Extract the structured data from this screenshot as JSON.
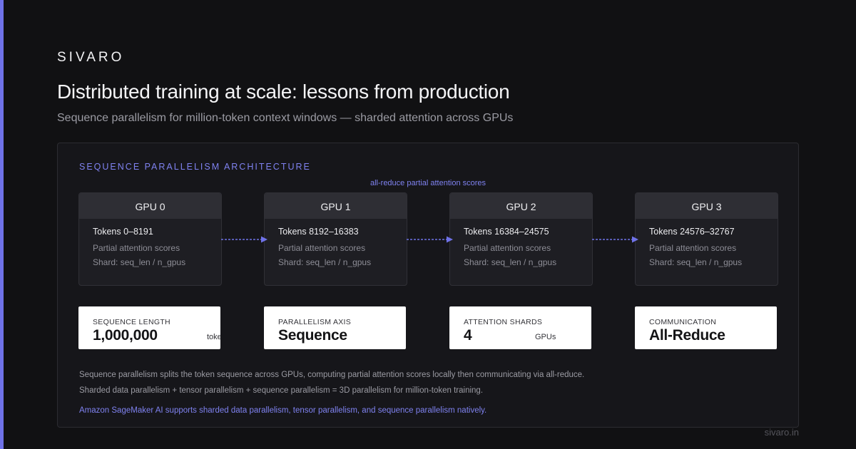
{
  "brand": "SIVARO",
  "title": "Distributed training at scale: lessons from production",
  "subtitle": "Sequence parallelism for million-token context windows — sharded attention across GPUs",
  "diagram": {
    "section_label": "SEQUENCE PARALLELISM ARCHITECTURE",
    "allreduce_label": "all-reduce partial attention scores",
    "gpus": [
      {
        "name": "GPU 0",
        "tokens": "Tokens 0–8191",
        "line1": "Partial attention scores",
        "line2": "Shard: seq_len / n_gpus"
      },
      {
        "name": "GPU 1",
        "tokens": "Tokens 8192–16383",
        "line1": "Partial attention scores",
        "line2": "Shard: seq_len / n_gpus"
      },
      {
        "name": "GPU 2",
        "tokens": "Tokens 16384–24575",
        "line1": "Partial attention scores",
        "line2": "Shard: seq_len / n_gpus"
      },
      {
        "name": "GPU 3",
        "tokens": "Tokens 24576–32767",
        "line1": "Partial attention scores",
        "line2": "Shard: seq_len / n_gpus"
      }
    ],
    "stats": [
      {
        "label": "SEQUENCE LENGTH",
        "value": "1,000,000",
        "unit": "tokens"
      },
      {
        "label": "PARALLELISM AXIS",
        "value": "Sequence",
        "unit": ""
      },
      {
        "label": "ATTENTION SHARDS",
        "value": "4",
        "unit": "GPUs"
      },
      {
        "label": "COMMUNICATION",
        "value": "All-Reduce",
        "unit": ""
      }
    ],
    "notes": [
      "Sequence parallelism splits the token sequence across GPUs, computing partial attention scores locally then communicating via all-reduce.",
      "Sharded data parallelism + tensor parallelism + sequence parallelism = 3D parallelism for million-token training."
    ],
    "accent_note": "Amazon SageMaker AI supports sharded data parallelism, tensor parallelism, and sequence parallelism natively."
  },
  "footer": "sivaro.in",
  "colors": {
    "accent": "#6f72e8",
    "background": "#111113",
    "panel": "#16161a"
  }
}
